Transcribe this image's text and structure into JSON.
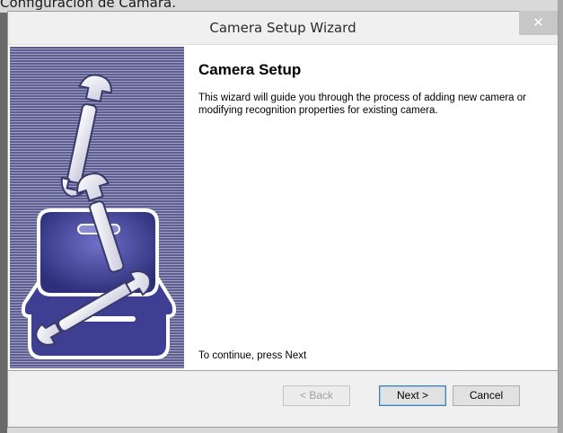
{
  "background": {
    "caption": "Configuración de Cámara."
  },
  "dialog": {
    "title": "Camera Setup Wizard",
    "close_label": "✕",
    "heading": "Camera Setup",
    "description": "This wizard will guide you through the process of adding new camera or modifying recognition properties for existing camera.",
    "footer_text": "To continue, press Next",
    "buttons": {
      "back": "< Back",
      "next": "Next >",
      "cancel": "Cancel"
    }
  },
  "icons": {
    "side_panel": "toolbox-wrench-icon"
  },
  "colors": {
    "panel_stripe_dark": "#5e5f8f",
    "panel_stripe_light": "#9fa0c7",
    "close_button": "#c7c7c7",
    "default_button_border": "#3c7fb1"
  }
}
